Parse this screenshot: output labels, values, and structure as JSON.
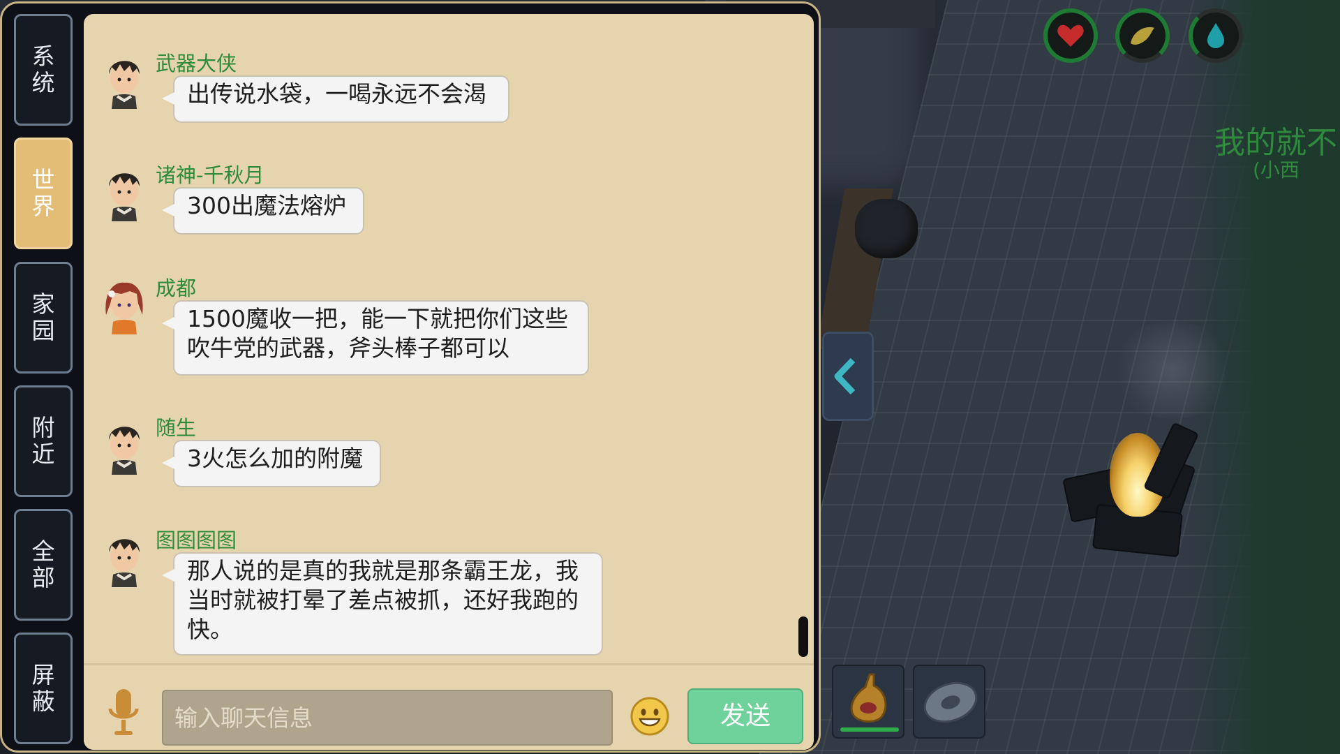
{
  "side_tabs": [
    {
      "label": "系统",
      "active": false
    },
    {
      "label": "世界",
      "active": true
    },
    {
      "label": "家园",
      "active": false
    },
    {
      "label": "附近",
      "active": false
    },
    {
      "label": "全部",
      "active": false
    },
    {
      "label": "屏蔽",
      "active": false
    }
  ],
  "messages": [
    {
      "name": "武器大侠",
      "text": "出传说水袋，一喝永远不会渴",
      "avatar": "boy-avatar"
    },
    {
      "name": "诸神-千秋月",
      "text": "300出魔法熔炉",
      "avatar": "boy-avatar"
    },
    {
      "name": "成都",
      "text": "1500魔收一把，能一下就把你们这些吹牛党的武器，斧头棒子都可以",
      "avatar": "girl-avatar"
    },
    {
      "name": "随生",
      "text": "3火怎么加的附魔",
      "avatar": "boy-avatar"
    },
    {
      "name": "图图图图",
      "text": "那人说的是真的我就是那条霸王龙，我当时就被打晕了差点被抓，还好我跑的快。",
      "avatar": "boy-avatar"
    }
  ],
  "input": {
    "placeholder": "输入聊天信息",
    "value": ""
  },
  "send_label": "发送",
  "scene": {
    "player_name": "我的就不",
    "player_subtitle": "(小西",
    "status": [
      "heart-icon",
      "food-icon",
      "water-drop-icon"
    ],
    "hotbar": [
      "water-bag-icon",
      "disc-icon"
    ]
  },
  "colors": {
    "accent": "#e3bd76",
    "name_green": "#2e8b3a",
    "send_green": "#6fd29a",
    "panel_bg": "#e6d4ae"
  }
}
